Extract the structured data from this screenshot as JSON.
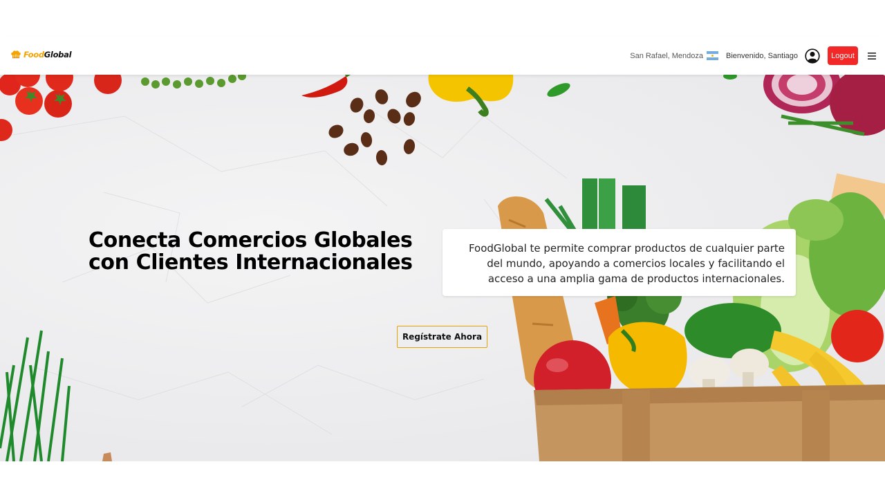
{
  "navbar": {
    "logo": {
      "part1": "Food",
      "part2": "Global"
    },
    "location": "San Rafael, Mendoza",
    "welcome": "Bienvenido, Santiago",
    "logout_label": "Logout",
    "icons": {
      "logo": "chef-hat-icon",
      "flag": "argentina-flag-icon",
      "user": "user-circle-icon",
      "menu": "hamburger-menu-icon"
    }
  },
  "hero": {
    "title": "Conecta Comercios Globales con Clientes Internacionales",
    "description": "FoodGlobal te permite comprar productos de cualquier parte del mundo, apoyando a comercios locales y facilitando el acceso a una amplia gama de productos internacionales.",
    "cta_label": "Regístrate Ahora"
  },
  "colors": {
    "brand_orange": "#f5a300",
    "logout_red": "#f22727",
    "cta_border": "#e6a300"
  }
}
